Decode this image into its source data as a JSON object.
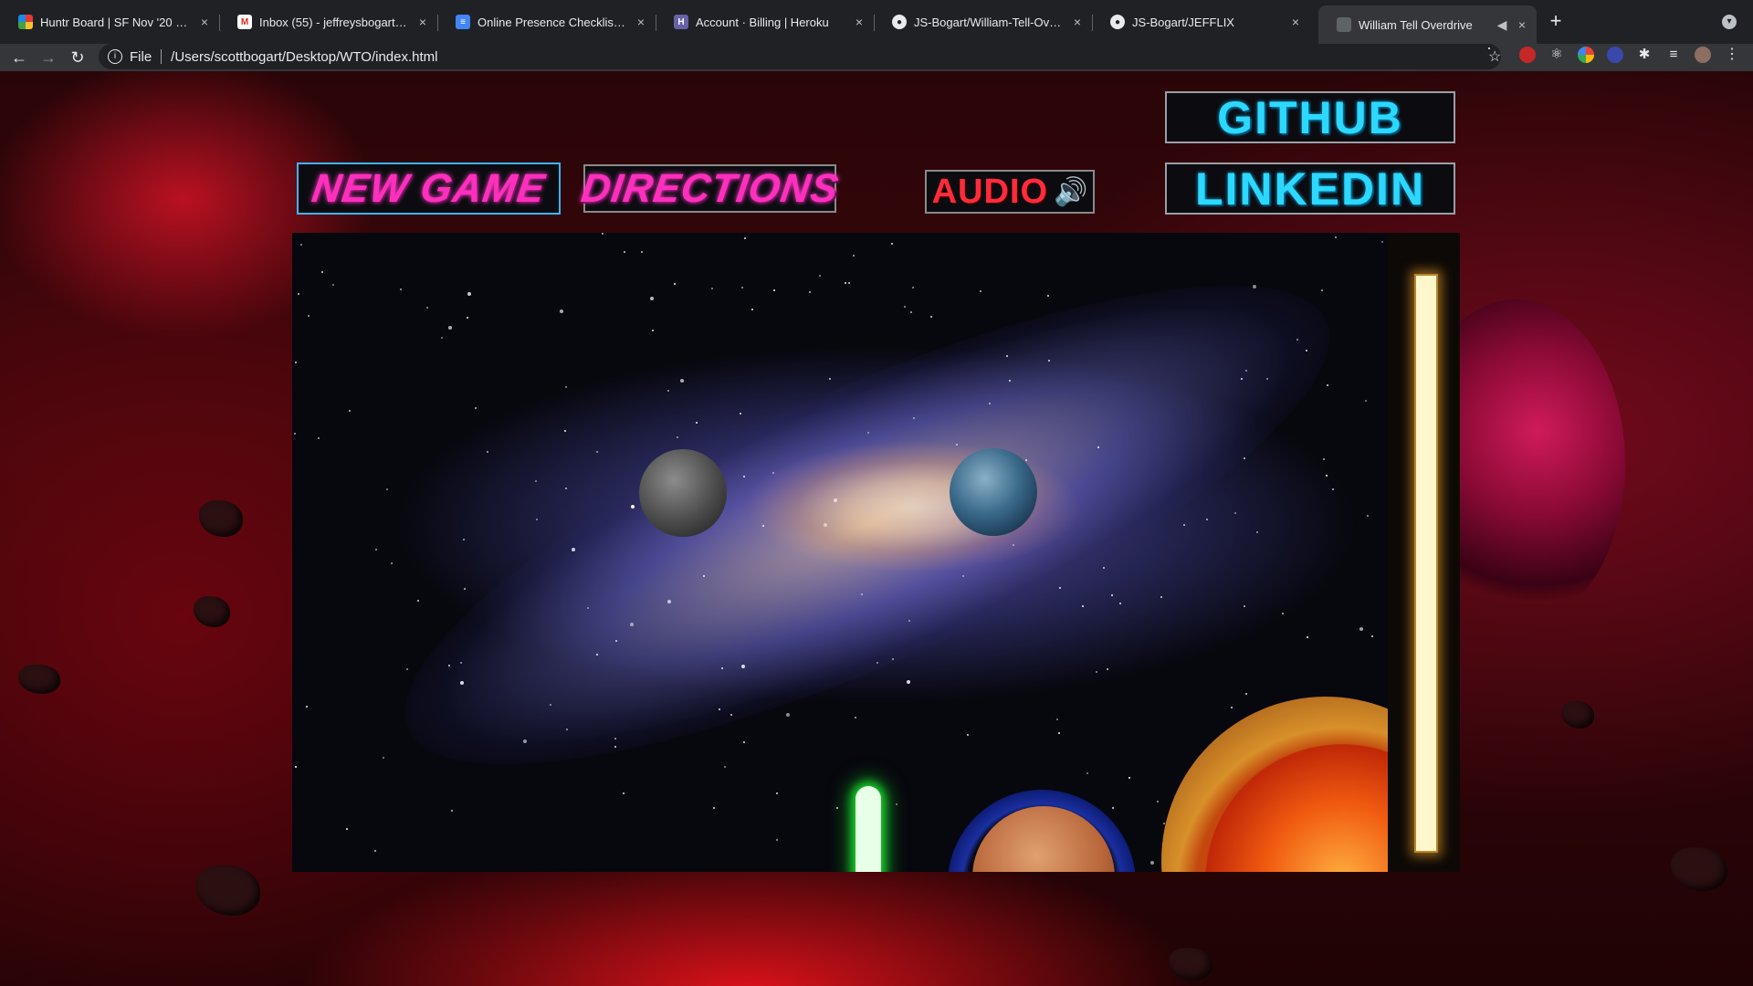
{
  "browser": {
    "tabs": [
      {
        "title": "Huntr Board | SF Nov '20 Board",
        "favicon": "huntr-icon"
      },
      {
        "title": "Inbox (55) - jeffreysbogart@gmail.com",
        "favicon": "gmail-icon"
      },
      {
        "title": "Online Presence Checklist (student",
        "favicon": "docs-icon"
      },
      {
        "title": "Account · Billing | Heroku",
        "favicon": "heroku-icon"
      },
      {
        "title": "JS-Bogart/William-Tell-Overdrive",
        "favicon": "github-icon"
      },
      {
        "title": "JS-Bogart/JEFFLIX",
        "favicon": "github-icon"
      },
      {
        "title": "William Tell Overdrive",
        "favicon": "page-icon",
        "active": true
      }
    ],
    "close_glyph": "×",
    "new_tab_glyph": "+",
    "address": {
      "scheme_label": "File",
      "path": "/Users/scottbogart/Desktop/WTO/index.html"
    }
  },
  "game_menu": {
    "new_game": "NEW GAME",
    "directions": "DIRECTIONS",
    "audio": "AUDIO",
    "github": "GITHUB",
    "linkedin": "LINKEDIN"
  },
  "power_meter": {
    "level": 1.0
  },
  "colors": {
    "accent_pink": "#ff2fbd",
    "accent_cyan": "#2dd8ff",
    "audio_red": "#ff2b3a",
    "saber_green": "#19d42a"
  }
}
